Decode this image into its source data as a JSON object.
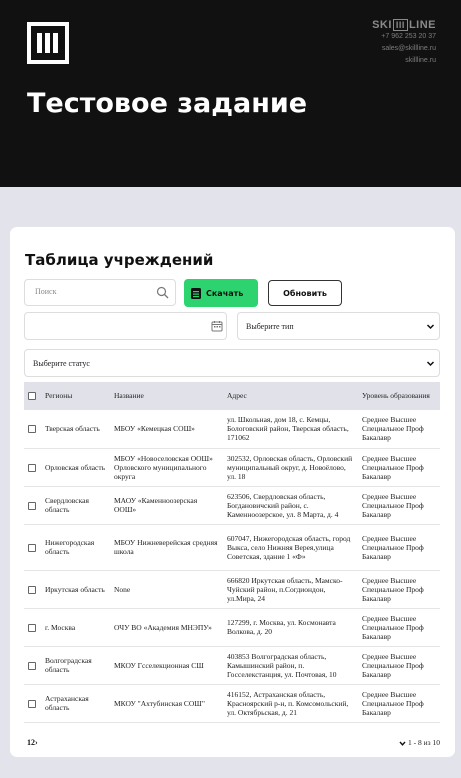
{
  "brand": {
    "name_left": "SKI",
    "name_mark": "III",
    "name_right": "LINE",
    "phone": "+7 962 253 20 37",
    "email": "sales@skillline.ru",
    "site": "skillline.ru"
  },
  "page": {
    "title": "Тестовое задание"
  },
  "card": {
    "title": "Таблица учреждений",
    "search_placeholder": "Поиск",
    "download_label": "Скачать",
    "refresh_label": "Обновить",
    "type_select": "Выберите тип",
    "status_select": "Выберите статус"
  },
  "table": {
    "headers": [
      "Регионы",
      "Название",
      "Адрес",
      "Уровень образования"
    ],
    "rows": [
      {
        "region": "Тверская область",
        "name": "МБОУ «Кемецкая СОШ»",
        "address": "ул. Школьная, дом 18, с. Кемцы, Бологовский район, Тверская область, 171062",
        "levels": [
          "Среднее Высшее",
          "Специальное Проф",
          "Бакалавр"
        ]
      },
      {
        "region": "Орловская область",
        "name": "МБОУ «Новоселовская ООШ» Орловского муниципального округа",
        "address": "302532, Орловская область, Орловский муниципальный округ, д. Новоёлово, ул. 18",
        "levels": [
          "Среднее Высшее",
          "Специальное Проф",
          "Бакалавр"
        ]
      },
      {
        "region": "Свердловская область",
        "name": "МАОУ «Каменноозерская ООШ»",
        "address": "623506, Свердловская область, Богдановичский район, с. Каменноозерское, ул. 8 Марта, д. 4",
        "levels": [
          "Среднее Высшее",
          "Специальное Проф",
          "Бакалавр"
        ]
      },
      {
        "region": "Нижегородская область",
        "name": "МБОУ Нижневерейская средняя школа",
        "address": "607047, Нижегородская область, город Выкса, село Нижняя Верея,улица Советская, здание 1 «Ф»",
        "levels": [
          "Среднее Высшее",
          "Специальное Проф",
          "Бакалавр"
        ]
      },
      {
        "region": "Иркутская область",
        "name": "None",
        "address": "666820 Иркутская область, Мамско-Чуйский район, п.Согдиондон, ул.Мира, 24",
        "levels": [
          "Среднее Высшее",
          "Специальное Проф",
          "Бакалавр"
        ]
      },
      {
        "region": "г. Москва",
        "name": "ОЧУ ВО «Академия МНЭПУ»",
        "address": "127299, г. Москва, ул. Космонавта Волкова, д. 20",
        "levels": [
          "Среднее Высшее",
          "Специальное Проф",
          "Бакалавр"
        ]
      },
      {
        "region": "Волгоградская область",
        "name": "МКОУ Гсселекционная СШ",
        "address": "403853 Волгоградская область, Камышинский район, п. Госселекстанция, ул. Почтовая, 10",
        "levels": [
          "Среднее Высшее",
          "Специальное Проф",
          "Бакалавр"
        ]
      },
      {
        "region": "Астраханская область",
        "name": "МКОУ \"Ахтубинская СОШ\"",
        "address": "416152, Астраханская область, Красноярский р-н, п. Комсомольский, ул. Октябрьская, д. 21",
        "levels": [
          "Среднее Высшее",
          "Специальное Проф",
          "Бакалавр"
        ]
      }
    ]
  },
  "pagination": {
    "pages": "12",
    "next": "›",
    "range": "1 - 8 из 10"
  },
  "colors": {
    "header": "#111111",
    "accent": "#2dd36f",
    "page_bg": "#e3e3ec"
  }
}
